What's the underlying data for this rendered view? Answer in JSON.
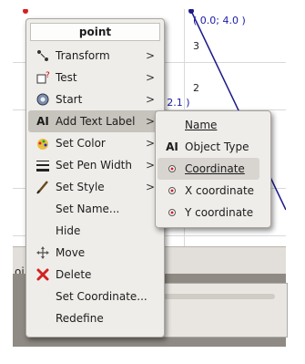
{
  "canvas": {
    "coord_top": "( 0.0; 4.0 )",
    "coord_mid": "; 2.1 )",
    "y_tick_3": "3",
    "y_tick_2": "2",
    "status_text": "oi"
  },
  "menu": {
    "title": "point",
    "items": [
      {
        "label": "Transform",
        "icon": "transform-icon",
        "submenu": true
      },
      {
        "label": "Test",
        "icon": "test-icon",
        "submenu": true
      },
      {
        "label": "Start",
        "icon": "start-icon",
        "submenu": true
      },
      {
        "label": "Add Text Label",
        "icon": "text-label-icon",
        "submenu": true
      },
      {
        "label": "Set Color",
        "icon": "color-icon",
        "submenu": true
      },
      {
        "label": "Set Pen Width",
        "icon": "pen-width-icon",
        "submenu": true
      },
      {
        "label": "Set Style",
        "icon": "style-icon",
        "submenu": true
      },
      {
        "label": "Set Name...",
        "icon": "",
        "submenu": false
      },
      {
        "label": "Hide",
        "icon": "",
        "submenu": false
      },
      {
        "label": "Move",
        "icon": "move-icon",
        "submenu": false
      },
      {
        "label": "Delete",
        "icon": "delete-icon",
        "submenu": false
      },
      {
        "label": "Set Coordinate...",
        "icon": "",
        "submenu": false
      },
      {
        "label": "Redefine",
        "icon": "",
        "submenu": false
      }
    ]
  },
  "submenu": {
    "items": [
      {
        "label": "Name",
        "icon": ""
      },
      {
        "label": "Object Type",
        "icon": "text-label-icon"
      },
      {
        "label": "Coordinate",
        "icon": "point-icon"
      },
      {
        "label": "X coordinate",
        "icon": "point-icon"
      },
      {
        "label": "Y coordinate",
        "icon": "point-icon"
      }
    ]
  },
  "colors": {
    "menu_bg": "#efedea",
    "highlight": "#c7c3bd",
    "coord_text": "#1a1aa6",
    "delete_red": "#d42020"
  }
}
